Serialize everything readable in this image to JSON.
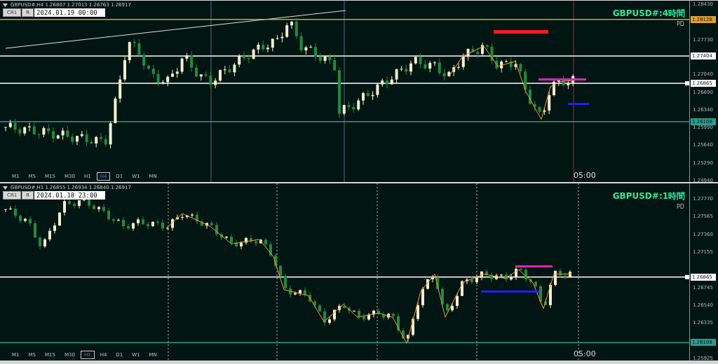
{
  "panels": [
    {
      "header": "GBPUSD#,H4  1.26807 1.27013 1.26763 1.26917",
      "buttons": [
        "CR1",
        "R"
      ],
      "date": "2024.01.19 00:00",
      "title": "GBPUSD#:4時間",
      "subtitle": "PD",
      "price_ticks": [
        "1.28430",
        "1.27730",
        "1.27040",
        "1.26690",
        "1.26340",
        "1.25990",
        "1.25640",
        "1.25290",
        "1.24940"
      ],
      "price_tags": [
        {
          "price": "1.28128",
          "color": "#e0a030"
        },
        {
          "price": "1.27404",
          "color": "#ffffff"
        },
        {
          "price": "1.26865",
          "color": "#ffffff"
        },
        {
          "price": "1.26108",
          "color": "#2a9d8f"
        }
      ],
      "timeframes": [
        {
          "label": "M1",
          "selected": false
        },
        {
          "label": "M5",
          "selected": false
        },
        {
          "label": "M15",
          "selected": false
        },
        {
          "label": "M30",
          "selected": false
        },
        {
          "label": "H1",
          "selected": false
        },
        {
          "label": "H4",
          "selected": true
        },
        {
          "label": "D1",
          "selected": false
        },
        {
          "label": "W1",
          "selected": false
        },
        {
          "label": "MN",
          "selected": false
        }
      ],
      "time_label": "05:00"
    },
    {
      "header": "GBPUSD#,H1  1.26855 1.26934 1.26840 1.26917",
      "buttons": [
        "CR1",
        "R"
      ],
      "date": "2024.01.18 23:00",
      "title": "GBPUSD#:1時間",
      "subtitle": "PD",
      "price_ticks": [
        "1.27770",
        "1.27565",
        "1.27360",
        "1.27155",
        "1.26745",
        "1.26540",
        "1.26335",
        "1.25925"
      ],
      "price_tags": [
        {
          "price": "1.26865",
          "color": "#ffffff"
        },
        {
          "price": "1.26108",
          "color": "#2a9d8f"
        }
      ],
      "timeframes": [
        {
          "label": "M1",
          "selected": false
        },
        {
          "label": "M5",
          "selected": false
        },
        {
          "label": "M15",
          "selected": false
        },
        {
          "label": "M30",
          "selected": false
        },
        {
          "label": "H1",
          "selected": true
        },
        {
          "label": "H4",
          "selected": false
        },
        {
          "label": "D1",
          "selected": false
        },
        {
          "label": "W1",
          "selected": false
        },
        {
          "label": "MN",
          "selected": false
        }
      ],
      "time_label": "05:00"
    }
  ]
}
